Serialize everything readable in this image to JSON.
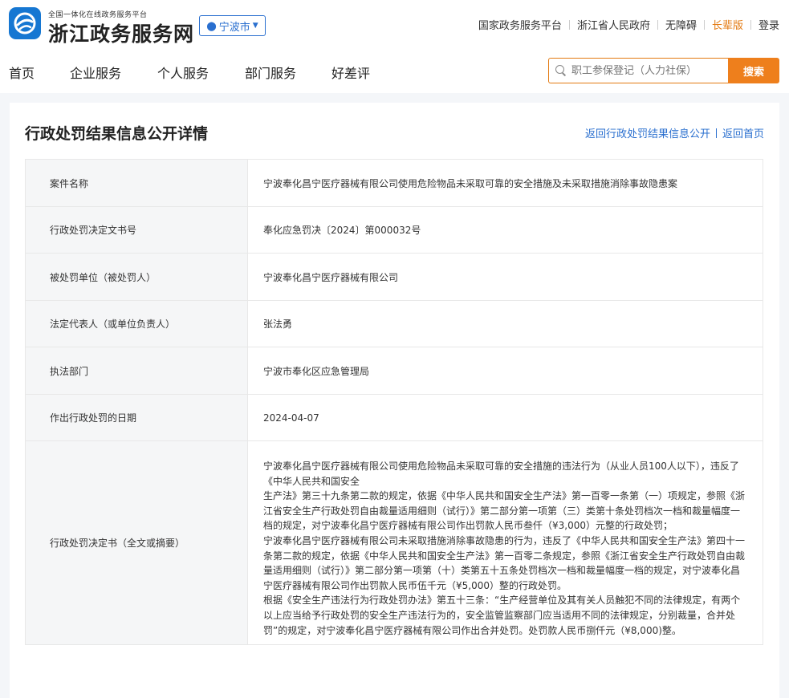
{
  "header": {
    "logo_subtitle": "全国一体化在线政务服务平台",
    "logo_title": "浙江政务服务网",
    "city": "宁波市",
    "top_links": [
      {
        "label": "国家政务服务平台"
      },
      {
        "label": "浙江省人民政府"
      },
      {
        "label": "无障碍"
      },
      {
        "label": "长辈版"
      },
      {
        "label": "登录"
      }
    ],
    "accent_color": "#e37a12"
  },
  "nav": {
    "items": [
      "首页",
      "企业服务",
      "个人服务",
      "部门服务",
      "好差评"
    ]
  },
  "search": {
    "placeholder": "职工参保登记（人力社保）",
    "button": "搜索"
  },
  "page": {
    "title": "行政处罚结果信息公开详情",
    "back_list": "返回行政处罚结果信息公开",
    "back_home": "返回首页"
  },
  "detail": {
    "rows": [
      {
        "label": "案件名称",
        "value": "宁波奉化昌宁医疗器械有限公司使用危险物品未采取可靠的安全措施及未采取措施消除事故隐患案"
      },
      {
        "label": "行政处罚决定文书号",
        "value": "奉化应急罚决〔2024〕第000032号"
      },
      {
        "label": "被处罚单位（被处罚人）",
        "value": "宁波奉化昌宁医疗器械有限公司"
      },
      {
        "label": "法定代表人（或单位负责人）",
        "value": "张法勇"
      },
      {
        "label": "执法部门",
        "value": "宁波市奉化区应急管理局"
      },
      {
        "label": "作出行政处罚的日期",
        "value": "2024-04-07"
      }
    ],
    "decision": {
      "label": "行政处罚决定书（全文或摘要）",
      "paragraphs": [
        "宁波奉化昌宁医疗器械有限公司使用危险物品未采取可靠的安全措施的违法行为（从业人员100人以下），违反了《中华人民共和国安全",
        "生产法》第三十九条第二款的规定，依据《中华人民共和国安全生产法》第一百零一条第（一）项规定，参照《浙江省安全生产行政处罚自由裁量适用细则（试行）》第二部分第一项第（三）类第十条处罚档次一档和裁量幅度一档的规定，对宁波奉化昌宁医疗器械有限公司作出罚款人民币叁仟（¥3,000）元整的行政处罚；",
        "宁波奉化昌宁医疗器械有限公司未采取措施消除事故隐患的行为，违反了《中华人民共和国安全生产法》第四十一条第二款的规定，依据《中华人民共和国安全生产法》第一百零二条规定，参照《浙江省安全生产行政处罚自由裁量适用细则（试行）》第二部分第一项第（十）类第五十五条处罚档次一档和裁量幅度一档的规定，对宁波奉化昌宁医疗器械有限公司作出罚款人民币伍千元（¥5,000）整的行政处罚。",
        "根据《安全生产违法行为行政处罚办法》第五十三条：“生产经营单位及其有关人员触犯不同的法律规定，有两个以上应当给予行政处罚的安全生产违法行为的，安全监管监察部门应当适用不同的法律规定，分别裁量，合并处罚”的规定，对宁波奉化昌宁医疗器械有限公司作出合并处罚。处罚款人民币捌仟元（¥8,000)整。"
      ]
    }
  }
}
